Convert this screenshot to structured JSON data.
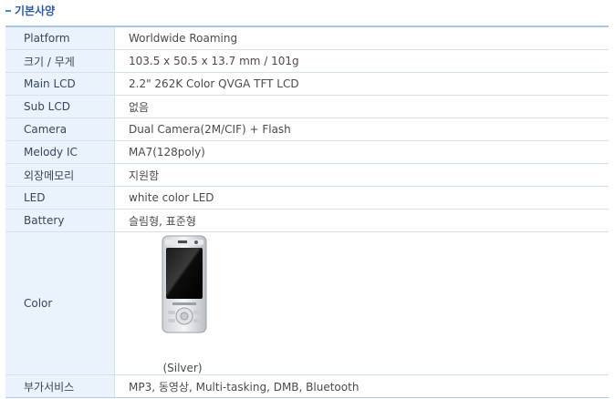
{
  "section": {
    "title": "기본사양"
  },
  "specs": [
    {
      "label": "Platform",
      "value": "Worldwide Roaming"
    },
    {
      "label": "크기 / 무게",
      "value": "103.5 x 50.5 x 13.7 mm / 101g"
    },
    {
      "label": "Main LCD",
      "value": "2.2\" 262K Color QVGA TFT LCD"
    },
    {
      "label": "Sub LCD",
      "value": "없음"
    },
    {
      "label": "Camera",
      "value": "Dual Camera(2M/CIF) + Flash"
    },
    {
      "label": "Melody IC",
      "value": "MA7(128poly)"
    },
    {
      "label": "외장메모리",
      "value": "지원함"
    },
    {
      "label": "LED",
      "value": "white color LED"
    },
    {
      "label": "Battery",
      "value": "슬림형, 표준형"
    }
  ],
  "color_row": {
    "label": "Color",
    "caption": "(Silver)"
  },
  "services": {
    "label": "부가서비스",
    "value": "MP3, 동영상, Multi-tasking, DMB, Bluetooth"
  }
}
